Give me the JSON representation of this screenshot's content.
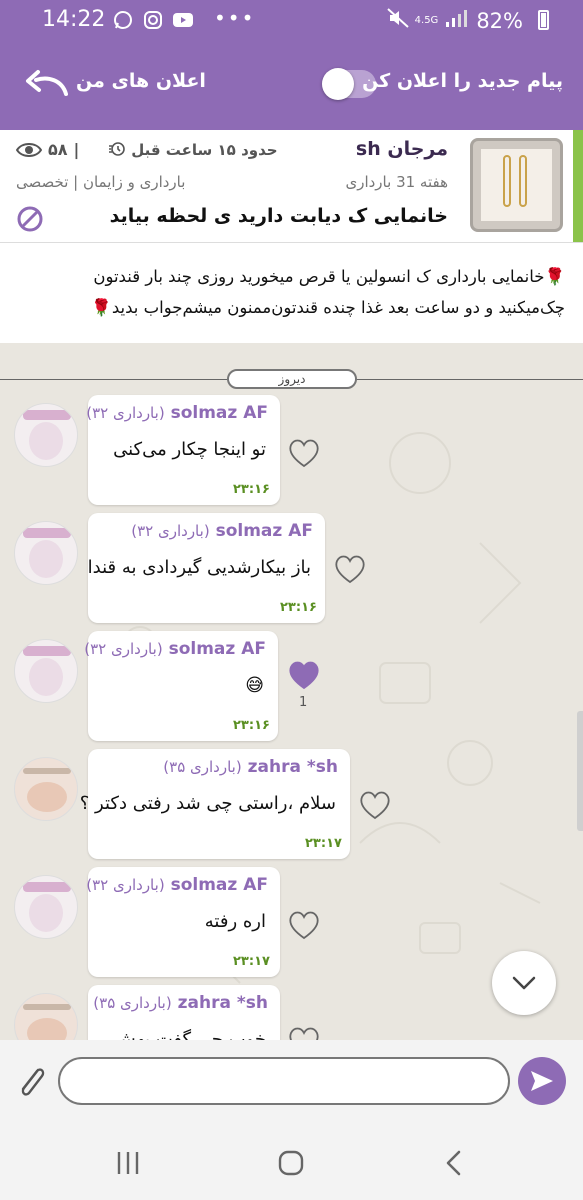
{
  "status_bar": {
    "time": "14:22",
    "network": "4.5G",
    "battery": "82%",
    "icons": [
      "whatsapp-icon",
      "instagram-icon",
      "youtube-icon",
      "more-dots-icon",
      "mute-icon",
      "signal-icon",
      "battery-icon"
    ]
  },
  "app_bar": {
    "announcements_label": "اعلان های من",
    "new_message_label": "پیام جدید را اعلان کن",
    "toggle_on": false
  },
  "post": {
    "author": "مرجان sh",
    "time_ago": "حدود ۱۵ ساعت قبل",
    "views": "۵۸",
    "week": "هفته 31 بارداری",
    "category": "بارداری و زایمان | تخصصی",
    "title": "خانمایی ک دیابت دارید ی لحظه بیاید",
    "body_line1": "🌹خانمایی بارداری ک انسولین یا قرص میخورید روزی چند بار قندتون",
    "body_line2": "چک‌میکنید و دو ساعت بعد غذا چنده قندتون‌ممنون میشم‌جواب بدید🌹"
  },
  "chat": {
    "date_divider": "دیروز",
    "messages": [
      {
        "sender": "solmaz AF",
        "week": "(۳۲ بارداری)",
        "text": "تو اینجا چکار می‌کنی",
        "time": "۲۳:۱۶",
        "liked": false,
        "like_count": ""
      },
      {
        "sender": "solmaz AF",
        "week": "(۳۲ بارداری)",
        "text": "باز بیکارشدیی گیردادی به قندا",
        "time": "۲۳:۱۶",
        "liked": false,
        "like_count": ""
      },
      {
        "sender": "solmaz AF",
        "week": "(۳۲ بارداری)",
        "text": "😅",
        "time": "۲۳:۱۶",
        "liked": true,
        "like_count": "1"
      },
      {
        "sender": "zahra *sh",
        "week": "(۳۵ بارداری)",
        "text": "سلام ،راستی چی شد رفتی دکتر ؟",
        "time": "۲۳:۱۷",
        "liked": false,
        "like_count": ""
      },
      {
        "sender": "solmaz AF",
        "week": "(۳۲ بارداری)",
        "text": "اره رفته",
        "time": "۲۳:۱۷",
        "liked": false,
        "like_count": ""
      },
      {
        "sender": "zahra *sh",
        "week": "(۳۵ بارداری)",
        "text": "خوب چی گفت بهش",
        "time": "",
        "liked": false,
        "like_count": ""
      }
    ]
  },
  "composer": {
    "placeholder": ""
  },
  "colors": {
    "primary": "#8e6bb5",
    "accent_green": "#8bc34a",
    "time_green": "#5a8f22"
  }
}
